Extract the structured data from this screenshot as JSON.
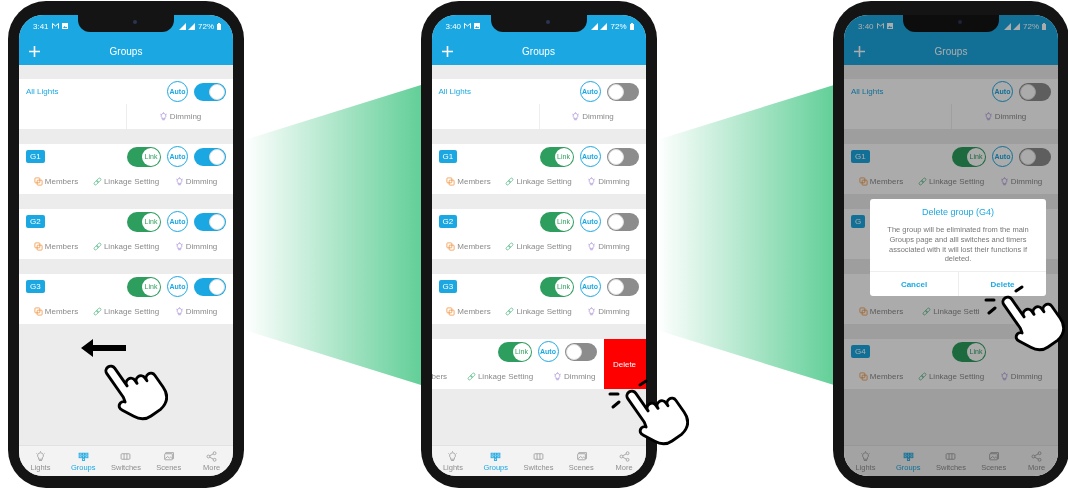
{
  "phones": [
    {
      "status": {
        "time": "3:41",
        "battery": "72%"
      },
      "header": {
        "title": "Groups"
      },
      "dimmed": false,
      "all_lights": {
        "name": "All Lights",
        "auto": "Auto",
        "power_on": true,
        "action": "Dimming"
      },
      "groups": [
        {
          "kind": "card",
          "badge": "G1",
          "link": "Link",
          "auto": "Auto",
          "power_on": true,
          "actions": [
            {
              "kind": "members",
              "label": "Members"
            },
            {
              "kind": "linkage",
              "label": "Linkage Setting"
            },
            {
              "kind": "dimming",
              "label": "Dimming"
            }
          ]
        },
        {
          "kind": "card",
          "badge": "G2",
          "link": "Link",
          "auto": "Auto",
          "power_on": true,
          "actions": [
            {
              "kind": "members",
              "label": "Members"
            },
            {
              "kind": "linkage",
              "label": "Linkage Setting"
            },
            {
              "kind": "dimming",
              "label": "Dimming"
            }
          ]
        },
        {
          "kind": "card",
          "badge": "G3",
          "link": "Link",
          "auto": "Auto",
          "power_on": true,
          "actions": [
            {
              "kind": "members",
              "label": "Members"
            },
            {
              "kind": "linkage",
              "label": "Linkage Setting"
            },
            {
              "kind": "dimming",
              "label": "Dimming"
            }
          ]
        }
      ],
      "gesture": {
        "kind": "swipe"
      },
      "nav": [
        {
          "label": "Lights",
          "selected": false
        },
        {
          "label": "Groups",
          "selected": true
        },
        {
          "label": "Switches",
          "selected": false
        },
        {
          "label": "Scenes",
          "selected": false
        },
        {
          "label": "More",
          "selected": false
        }
      ]
    },
    {
      "status": {
        "time": "3:40",
        "battery": "72%"
      },
      "header": {
        "title": "Groups"
      },
      "dimmed": false,
      "all_lights": {
        "name": "All Lights",
        "auto": "Auto",
        "power_on": false,
        "action": "Dimming"
      },
      "groups": [
        {
          "kind": "card",
          "badge": "G1",
          "link": "Link",
          "auto": "Auto",
          "power_on": false,
          "actions": [
            {
              "kind": "members",
              "label": "Members"
            },
            {
              "kind": "linkage",
              "label": "Linkage Setting"
            },
            {
              "kind": "dimming",
              "label": "Dimming"
            }
          ]
        },
        {
          "kind": "card",
          "badge": "G2",
          "link": "Link",
          "auto": "Auto",
          "power_on": false,
          "actions": [
            {
              "kind": "members",
              "label": "Members"
            },
            {
              "kind": "linkage",
              "label": "Linkage Setting"
            },
            {
              "kind": "dimming",
              "label": "Dimming"
            }
          ]
        },
        {
          "kind": "card",
          "badge": "G3",
          "link": "Link",
          "auto": "Auto",
          "power_on": false,
          "actions": [
            {
              "kind": "members",
              "label": "Members"
            },
            {
              "kind": "linkage",
              "label": "Linkage Setting"
            },
            {
              "kind": "dimming",
              "label": "Dimming"
            }
          ]
        },
        {
          "kind": "swiped",
          "link": "Link",
          "auto": "Auto",
          "power_on": false,
          "delete": "Delete",
          "actions": [
            {
              "kind": "partial",
              "label": "bers"
            },
            {
              "kind": "linkage",
              "label": "Linkage Setting"
            },
            {
              "kind": "dimming",
              "label": "Dimming"
            }
          ]
        }
      ],
      "gesture": {
        "kind": "tap-row"
      },
      "nav": [
        {
          "label": "Lights",
          "selected": false
        },
        {
          "label": "Groups",
          "selected": true
        },
        {
          "label": "Switches",
          "selected": false
        },
        {
          "label": "Scenes",
          "selected": false
        },
        {
          "label": "More",
          "selected": false
        }
      ]
    },
    {
      "status": {
        "time": "3:40",
        "battery": "72%"
      },
      "header": {
        "title": "Groups"
      },
      "dimmed": true,
      "all_lights": {
        "name": "All Lights",
        "auto": "Auto",
        "power_on": false,
        "action": "Dimming"
      },
      "groups": [
        {
          "kind": "card",
          "badge": "G1",
          "link": "Link",
          "auto": "Auto",
          "power_on": false,
          "actions": [
            {
              "kind": "members",
              "label": "Members"
            },
            {
              "kind": "linkage",
              "label": "Linkage Setting"
            },
            {
              "kind": "dimming",
              "label": "Dimming"
            }
          ]
        },
        {
          "kind": "card",
          "badge": "G"
        },
        {
          "kind": "card",
          "actions": [
            {
              "kind": "members",
              "label": "Members"
            },
            {
              "kind": "linkage",
              "label": "Linkage Setti"
            }
          ]
        },
        {
          "kind": "card",
          "badge": "G4",
          "link": "Link",
          "actions": [
            {
              "kind": "members",
              "label": "Members"
            },
            {
              "kind": "linkage",
              "label": "Linkage Setting"
            },
            {
              "kind": "dimming",
              "label": "Dimming"
            }
          ]
        }
      ],
      "dialog": {
        "title": "Delete group (G4)",
        "message": "The group will be eliminated from the main Groups page and alll switches and timers associated with it will lost their functions if deleted.",
        "buttons": [
          "Cancel",
          "Delete"
        ]
      },
      "gesture": {
        "kind": "tap-dialog"
      },
      "nav": [
        {
          "label": "Lights",
          "selected": false
        },
        {
          "label": "Groups",
          "selected": true
        },
        {
          "label": "Switches",
          "selected": false
        },
        {
          "label": "Scenes",
          "selected": false
        },
        {
          "label": "More",
          "selected": false
        }
      ]
    }
  ]
}
